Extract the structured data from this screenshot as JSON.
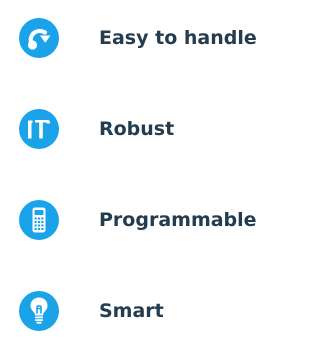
{
  "colors": {
    "accent": "#1aa3e8",
    "text": "#243c4e",
    "icon_fg": "#ffffff"
  },
  "features": [
    {
      "label": "Easy to handle",
      "icon": "turn-arrow-icon"
    },
    {
      "label": "Robust",
      "icon": "hammer-icon"
    },
    {
      "label": "Programmable",
      "icon": "remote-control-icon"
    },
    {
      "label": "Smart",
      "icon": "lightbulb-icon"
    }
  ]
}
